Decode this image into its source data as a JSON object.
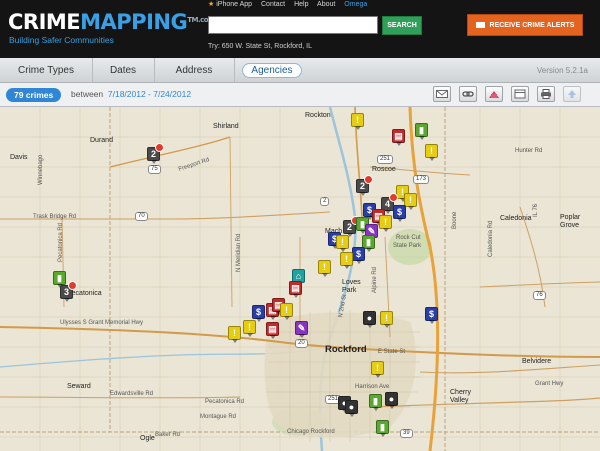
{
  "header": {
    "logo_crime": "CRIME",
    "logo_mapping": "MAPPING",
    "logo_tm": "TM",
    "logo_domain": ".com",
    "tagline": "Building Safer Communities",
    "links": {
      "iphone": "iPhone App",
      "contact": "Contact",
      "help": "Help",
      "about": "About",
      "omega": "Omega"
    },
    "search_value": "",
    "search_button": "SEARCH",
    "try_text": "Try: 650 W. State St, Rockford, IL",
    "alerts_button": "RECEIVE CRIME ALERTS"
  },
  "tabs": {
    "crime_types": "Crime Types",
    "dates": "Dates",
    "address": "Address",
    "agencies": "Agencies",
    "version": "Version 5.2.1a"
  },
  "filter": {
    "count": "79 crimes",
    "between_label": "between",
    "date_range": "7/18/2012 - 7/24/2012"
  },
  "toolbar": {
    "icons": [
      "email-icon",
      "link-icon",
      "share-icon",
      "table-icon",
      "print-icon",
      "scroll-up-icon"
    ]
  },
  "map": {
    "places": {
      "rockton": "Rockton",
      "shirland": "Shirland",
      "durand": "Durand",
      "davis": "Davis",
      "roscoe": "Roscoe",
      "machesney": "Mach",
      "loves_park": "Loves Park",
      "rockford": "Rockford",
      "pecatonica": "Pecatonica",
      "seward": "Seward",
      "caledonia": "Caledonia",
      "poplar_grove": "Poplar Grove",
      "belvidere": "Belvidere",
      "cherry_valley": "Cherry Valley",
      "hunter_rd": "Hunter Rd",
      "ogle": "Ogle",
      "rock_cut": "Rock Cut",
      "state_park": "State Park",
      "winnebago": "Winnebago",
      "boone": "Boone"
    },
    "roads": {
      "trask_bridge": "Trask Bridge Rd",
      "freeport": "Freeport Rd",
      "ulysses": "Ulysses S Grant Memorial Hwy",
      "edwardsville": "Edwardsville Rd",
      "harrison": "Harrison Ave",
      "grant_hwy": "Grant Hwy",
      "e_state": "E State St",
      "alpine": "Alpine Rd",
      "n_2nd": "N 2nd St",
      "meridian": "N Meridian Rd",
      "chicago": "Chicago Rockford",
      "montague": "Montague Rd",
      "pecatonica_rd": "Pecatonica Rd",
      "baker": "Baker Rd",
      "caledonia_rd": "Caledonia Rd",
      "il76": "IL 76",
      "belvidere_rd": "Belvidere Rd"
    },
    "routes": [
      "251",
      "75",
      "70",
      "2",
      "20",
      "76",
      "251",
      "39",
      "173"
    ],
    "marker_numbers": {
      "durand": "2",
      "pecatonica": "3",
      "roscoe": "2",
      "machesney": "2",
      "roscoe_east": "4"
    }
  }
}
